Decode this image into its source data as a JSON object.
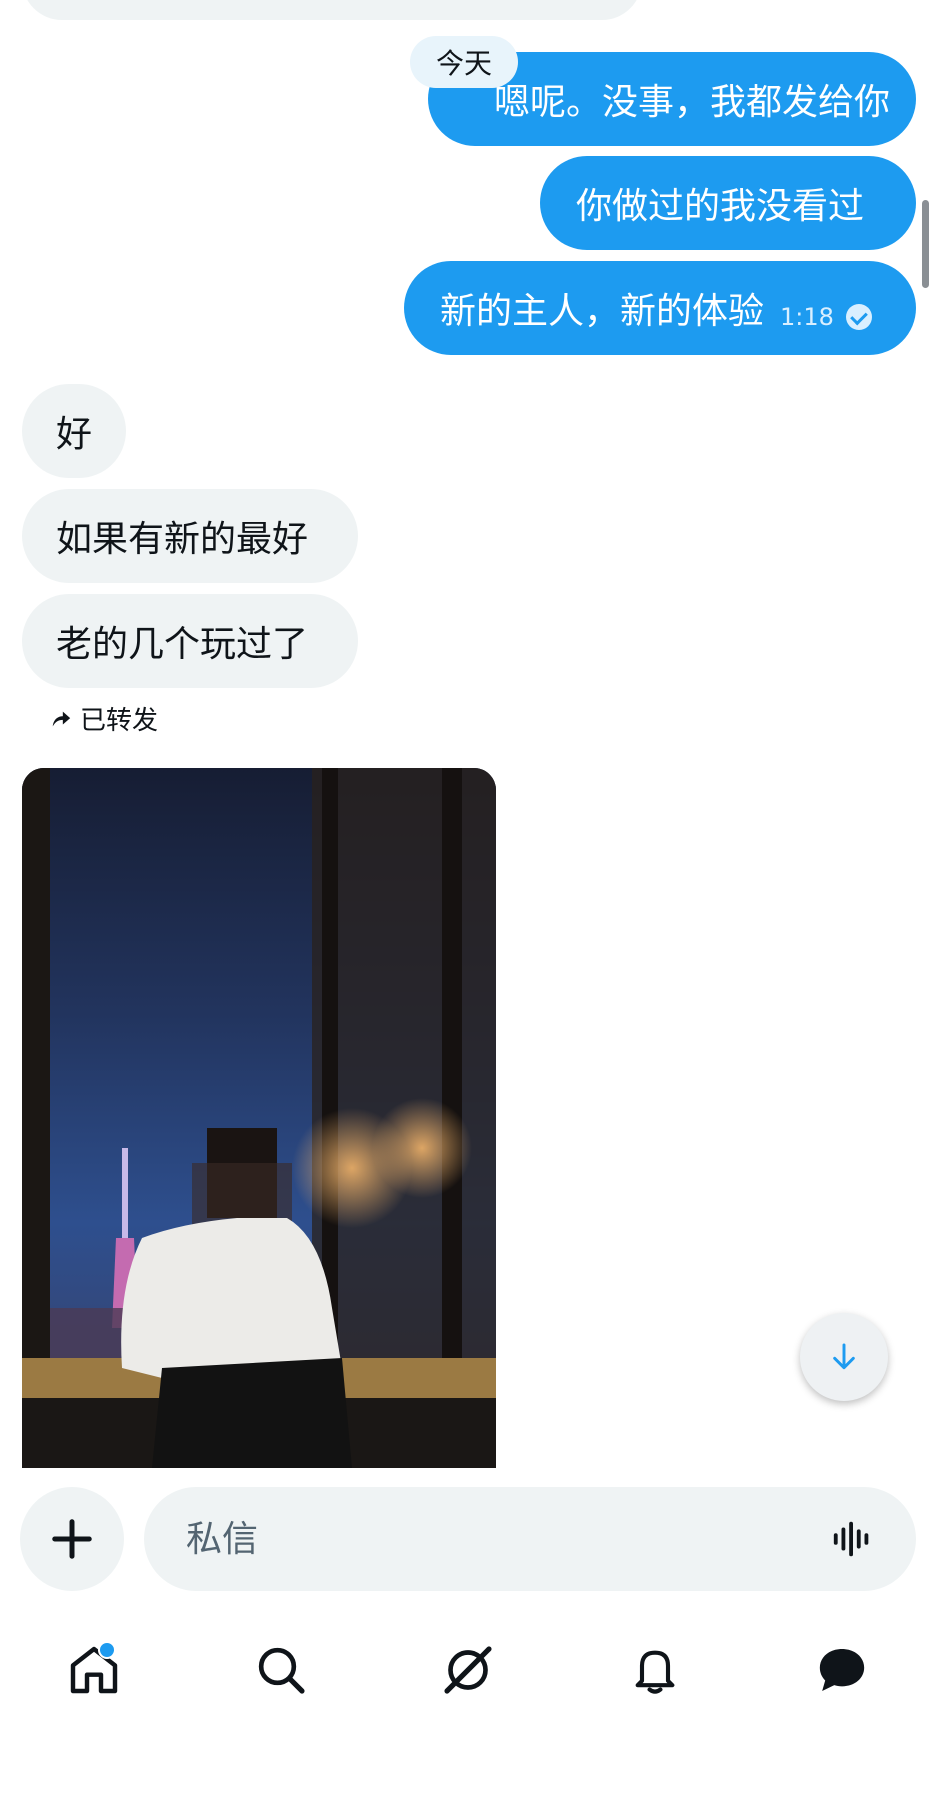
{
  "date_pill": "今天",
  "messages_out": [
    {
      "text": "嗯呢。没事，我都发给你"
    },
    {
      "text": "你做过的我没看过"
    },
    {
      "text": "新的主人，新的体验",
      "time": "1:18"
    }
  ],
  "messages_in": [
    {
      "text": "好"
    },
    {
      "text": "如果有新的最好"
    },
    {
      "text": "老的几个玩过了"
    }
  ],
  "forwarded_label": "已转发",
  "composer": {
    "placeholder": "私信"
  },
  "nav": {
    "items": [
      "home-icon",
      "search-icon",
      "grok-icon",
      "notifications-icon",
      "messages-icon"
    ],
    "home_has_dot": true
  },
  "colors": {
    "accent": "#1d9bf0",
    "bubble_in": "#eff3f4",
    "text": "#0f1419"
  }
}
